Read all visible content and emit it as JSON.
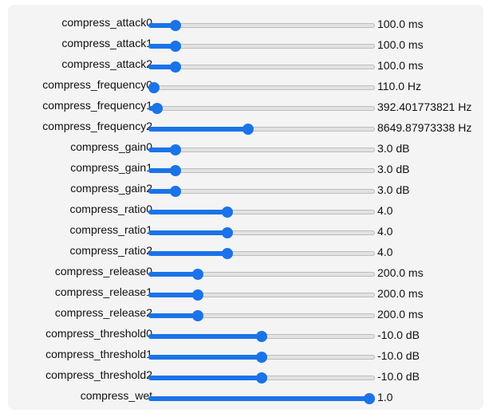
{
  "controls": [
    {
      "label": "compress_attack0",
      "value": "100.0 ms",
      "level": 0.12
    },
    {
      "label": "compress_attack1",
      "value": "100.0 ms",
      "level": 0.12
    },
    {
      "label": "compress_attack2",
      "value": "100.0 ms",
      "level": 0.12
    },
    {
      "label": "compress_frequency0",
      "value": "110.0 Hz",
      "level": 0.02
    },
    {
      "label": "compress_frequency1",
      "value": "392.401773821 Hz",
      "level": 0.04
    },
    {
      "label": "compress_frequency2",
      "value": "8649.87973338 Hz",
      "level": 0.44
    },
    {
      "label": "compress_gain0",
      "value": "3.0 dB",
      "level": 0.12
    },
    {
      "label": "compress_gain1",
      "value": "3.0 dB",
      "level": 0.12
    },
    {
      "label": "compress_gain2",
      "value": "3.0 dB",
      "level": 0.12
    },
    {
      "label": "compress_ratio0",
      "value": "4.0",
      "level": 0.35
    },
    {
      "label": "compress_ratio1",
      "value": "4.0",
      "level": 0.35
    },
    {
      "label": "compress_ratio2",
      "value": "4.0",
      "level": 0.35
    },
    {
      "label": "compress_release0",
      "value": "200.0 ms",
      "level": 0.22
    },
    {
      "label": "compress_release1",
      "value": "200.0 ms",
      "level": 0.22
    },
    {
      "label": "compress_release2",
      "value": "200.0 ms",
      "level": 0.22
    },
    {
      "label": "compress_threshold0",
      "value": "-10.0 dB",
      "level": 0.5
    },
    {
      "label": "compress_threshold1",
      "value": "-10.0 dB",
      "level": 0.5
    },
    {
      "label": "compress_threshold2",
      "value": "-10.0 dB",
      "level": 0.5
    },
    {
      "label": "compress_wet",
      "value": "1.0",
      "level": 1.0
    }
  ],
  "colors": {
    "accent": "#1a73e8",
    "track": "#e2e2e2",
    "track_border": "#bdbdbd",
    "panel": "#f4f4f4"
  }
}
